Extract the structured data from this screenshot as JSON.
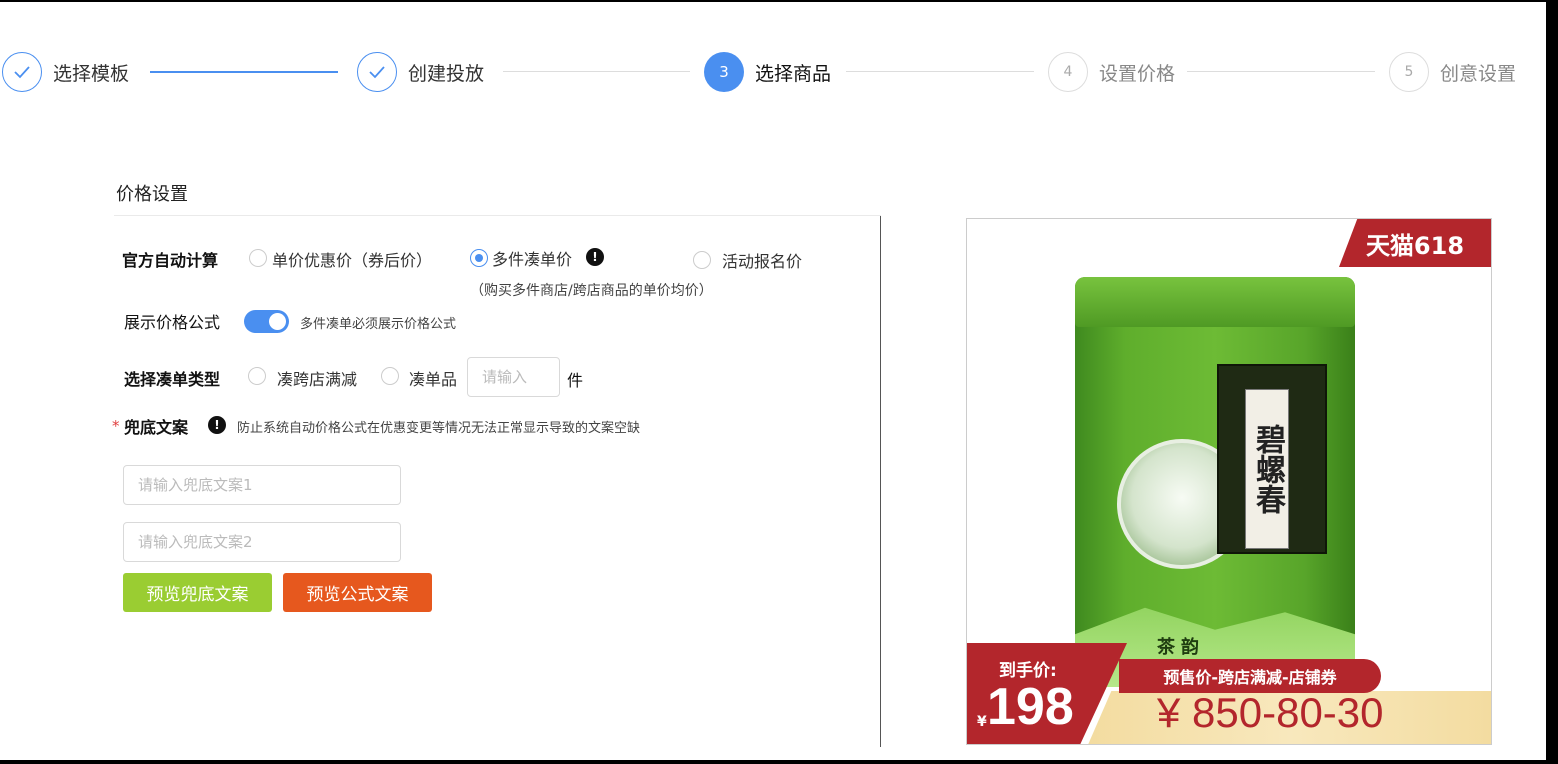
{
  "steps": [
    {
      "icon": "check-icon",
      "label": "选择模板",
      "state": "done"
    },
    {
      "icon": "check-icon",
      "label": "创建投放",
      "state": "done"
    },
    {
      "number": "3",
      "label": "选择商品",
      "state": "active"
    },
    {
      "number": "4",
      "label": "设置价格",
      "state": "todo"
    },
    {
      "number": "5",
      "label": "创意设置",
      "state": "todo"
    }
  ],
  "section_title": "价格设置",
  "auto_calc": {
    "label": "官方自动计算",
    "options": [
      "单价优惠价（券后价）",
      "多件凑单价",
      "活动报名价"
    ],
    "selected": "多件凑单价",
    "hint": "（购买多件商店/跨店商品的单价均价）"
  },
  "show_formula": {
    "label": "展示价格公式",
    "enabled": true,
    "hint": "多件凑单必须展示价格公式"
  },
  "combo_type": {
    "label": "选择凑单类型",
    "options": [
      "凑跨店满减",
      "凑单品"
    ],
    "input_placeholder": "请输入",
    "unit": "件"
  },
  "fallback": {
    "label": "兜底文案",
    "hint": "防止系统自动价格公式在优惠变更等情况无法正常显示导致的文案空缺",
    "input1_placeholder": "请输入兜底文案1",
    "input2_placeholder": "请输入兜底文案2"
  },
  "buttons": {
    "preview_fallback": "预览兜底文案",
    "preview_formula": "预览公式文案"
  },
  "preview": {
    "badge": "天猫618",
    "tin_title": "碧螺春",
    "tin_brand": "茶韵",
    "price_label": "到手价:",
    "price_currency": "¥",
    "price_value": "198",
    "formula_tag": "预售价-跨店满减-店铺券",
    "formula": "¥ 850-80-30"
  },
  "colors": {
    "primary": "#4a8ff0",
    "green_button": "#9acd32",
    "orange_button": "#e6581e",
    "brand_red": "#b3262c"
  }
}
